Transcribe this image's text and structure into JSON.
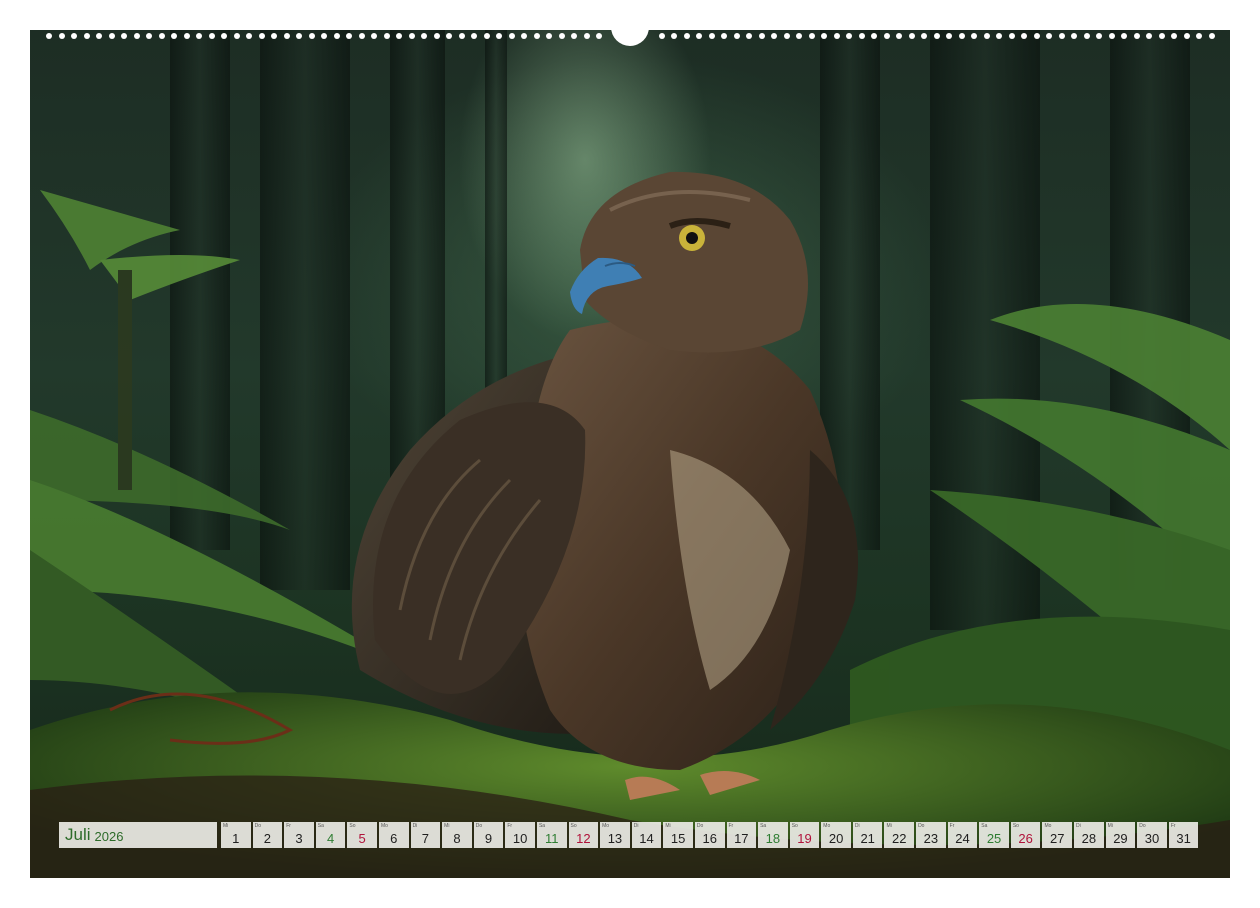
{
  "calendar": {
    "month": "Juli",
    "year": "2026",
    "days": [
      {
        "wd": "Mi",
        "n": "1",
        "type": "weekday"
      },
      {
        "wd": "Do",
        "n": "2",
        "type": "weekday"
      },
      {
        "wd": "Fr",
        "n": "3",
        "type": "weekday"
      },
      {
        "wd": "Sa",
        "n": "4",
        "type": "sat"
      },
      {
        "wd": "So",
        "n": "5",
        "type": "sun"
      },
      {
        "wd": "Mo",
        "n": "6",
        "type": "weekday"
      },
      {
        "wd": "Di",
        "n": "7",
        "type": "weekday"
      },
      {
        "wd": "Mi",
        "n": "8",
        "type": "weekday"
      },
      {
        "wd": "Do",
        "n": "9",
        "type": "weekday"
      },
      {
        "wd": "Fr",
        "n": "10",
        "type": "weekday"
      },
      {
        "wd": "Sa",
        "n": "11",
        "type": "sat"
      },
      {
        "wd": "So",
        "n": "12",
        "type": "sun"
      },
      {
        "wd": "Mo",
        "n": "13",
        "type": "weekday"
      },
      {
        "wd": "Di",
        "n": "14",
        "type": "weekday"
      },
      {
        "wd": "Mi",
        "n": "15",
        "type": "weekday"
      },
      {
        "wd": "Do",
        "n": "16",
        "type": "weekday"
      },
      {
        "wd": "Fr",
        "n": "17",
        "type": "weekday"
      },
      {
        "wd": "Sa",
        "n": "18",
        "type": "sat"
      },
      {
        "wd": "So",
        "n": "19",
        "type": "sun"
      },
      {
        "wd": "Mo",
        "n": "20",
        "type": "weekday"
      },
      {
        "wd": "Di",
        "n": "21",
        "type": "weekday"
      },
      {
        "wd": "Mi",
        "n": "22",
        "type": "weekday"
      },
      {
        "wd": "Do",
        "n": "23",
        "type": "weekday"
      },
      {
        "wd": "Fr",
        "n": "24",
        "type": "weekday"
      },
      {
        "wd": "Sa",
        "n": "25",
        "type": "sat"
      },
      {
        "wd": "So",
        "n": "26",
        "type": "sun"
      },
      {
        "wd": "Mo",
        "n": "27",
        "type": "weekday"
      },
      {
        "wd": "Di",
        "n": "28",
        "type": "weekday"
      },
      {
        "wd": "Mi",
        "n": "29",
        "type": "weekday"
      },
      {
        "wd": "Do",
        "n": "30",
        "type": "weekday"
      },
      {
        "wd": "Fr",
        "n": "31",
        "type": "weekday"
      }
    ]
  },
  "colors": {
    "saturday": "#2e7d32",
    "sunday": "#b0123a",
    "month_text": "#2d6b2a"
  },
  "image": {
    "icon": "hawk-in-forest-photo"
  }
}
